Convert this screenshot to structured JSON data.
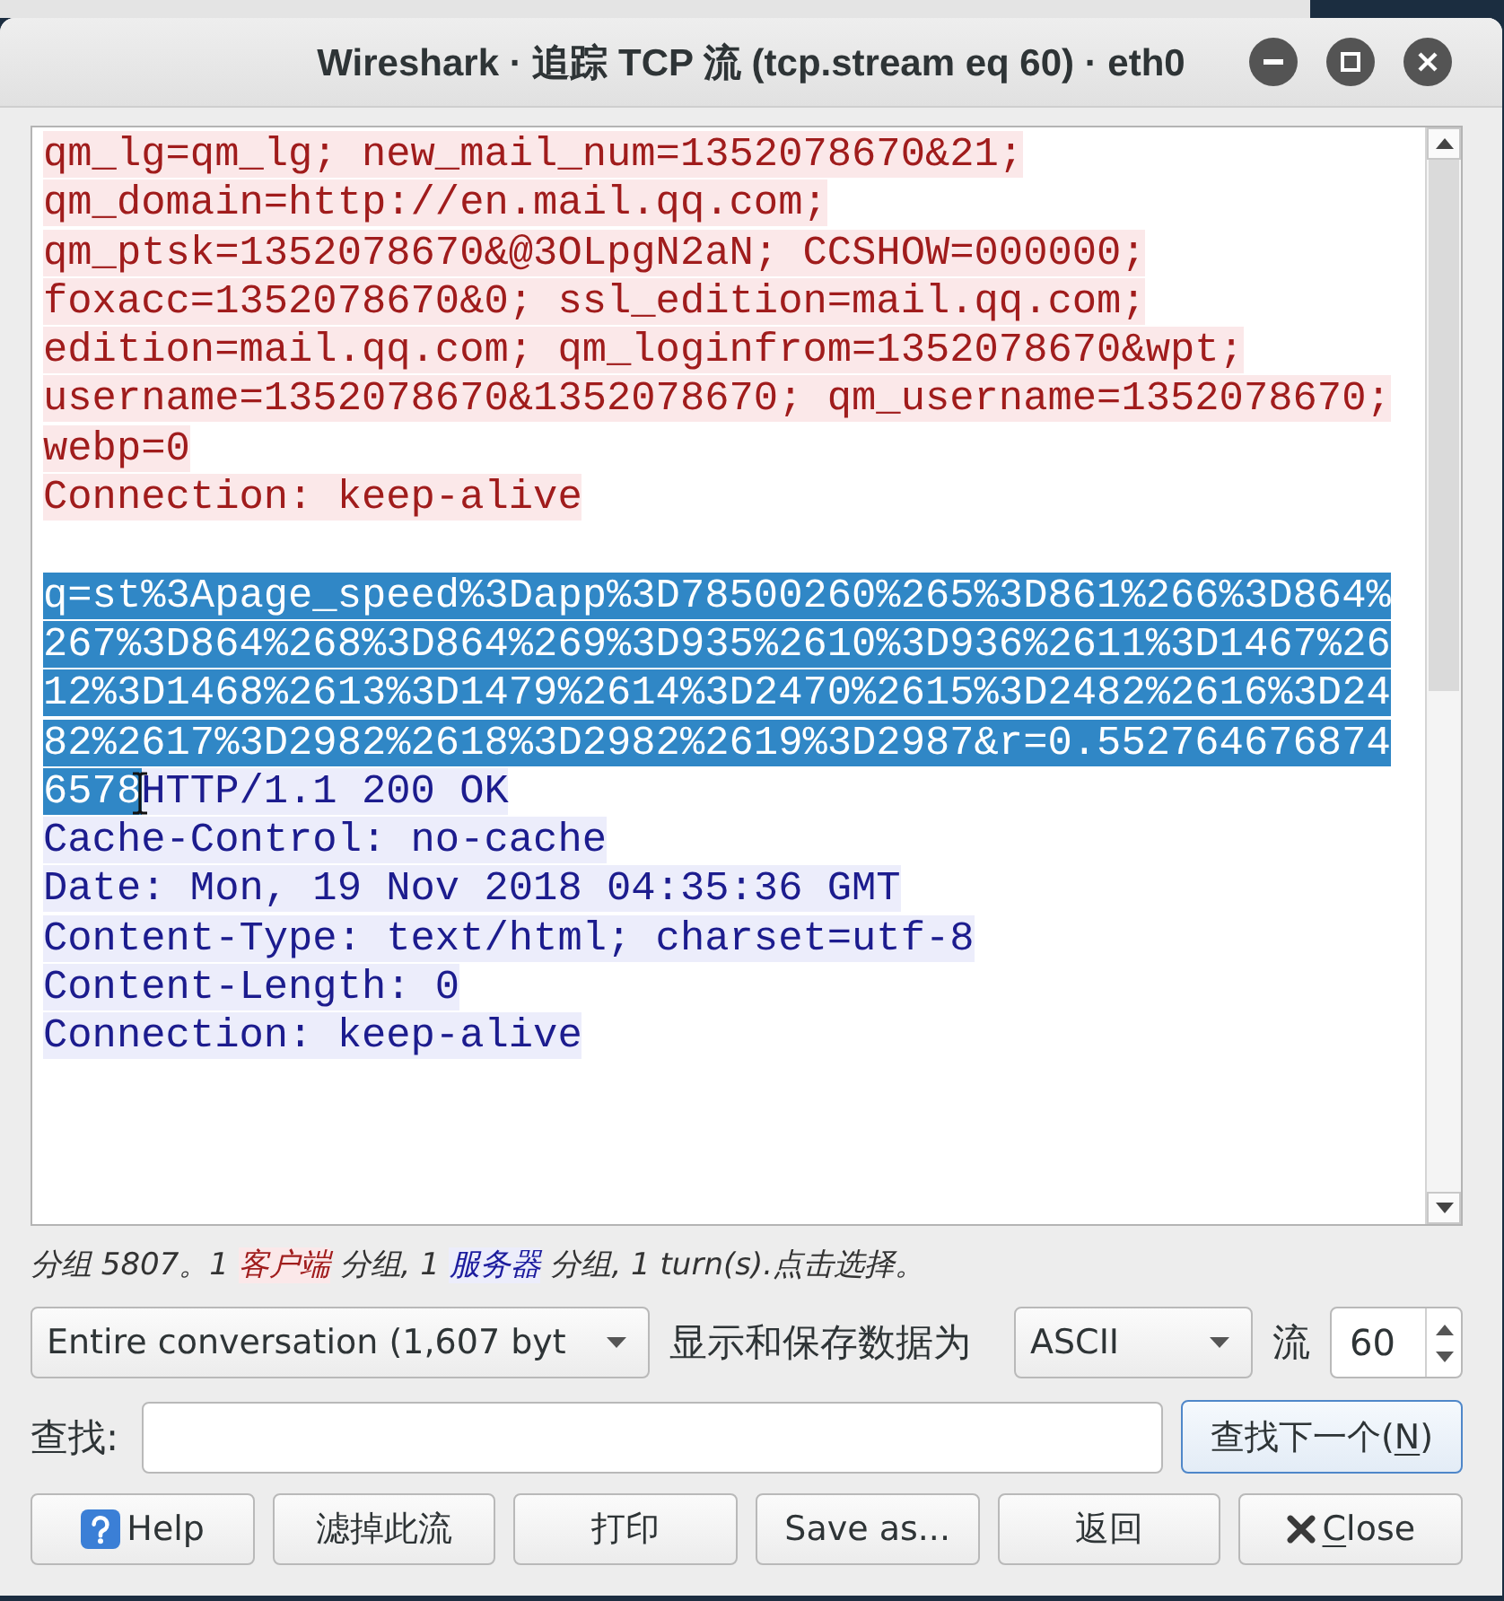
{
  "window": {
    "title": "Wireshark · 追踪 TCP 流 (tcp.stream eq 60) · eth0"
  },
  "stream": {
    "lines": [
      {
        "kind": "text",
        "segments": [
          {
            "kind": "client",
            "selected": false,
            "text": "qm_lg=qm_lg; new_mail_num=1352078670&21;"
          }
        ]
      },
      {
        "kind": "text",
        "segments": [
          {
            "kind": "client",
            "selected": false,
            "text": "qm_domain=http://en.mail.qq.com;"
          }
        ]
      },
      {
        "kind": "text",
        "segments": [
          {
            "kind": "client",
            "selected": false,
            "text": "qm_ptsk=1352078670&@3OLpgN2aN; CCSHOW=000000;"
          }
        ]
      },
      {
        "kind": "text",
        "segments": [
          {
            "kind": "client",
            "selected": false,
            "text": "foxacc=1352078670&0; ssl_edition=mail.qq.com;"
          }
        ]
      },
      {
        "kind": "text",
        "segments": [
          {
            "kind": "client",
            "selected": false,
            "text": "edition=mail.qq.com; qm_loginfrom=1352078670&wpt;"
          }
        ]
      },
      {
        "kind": "text",
        "segments": [
          {
            "kind": "client",
            "selected": false,
            "text": "username=1352078670&1352078670; qm_username=1352078670;"
          }
        ]
      },
      {
        "kind": "text",
        "segments": [
          {
            "kind": "client",
            "selected": false,
            "text": "webp=0"
          }
        ]
      },
      {
        "kind": "text",
        "segments": [
          {
            "kind": "client",
            "selected": false,
            "text": "Connection: keep-alive"
          }
        ]
      },
      {
        "kind": "blank"
      },
      {
        "kind": "text",
        "segments": [
          {
            "kind": "client",
            "selected": true,
            "text": "q=st%3Apage_speed%3Dapp%3D78500260%265%3D861%266%3D864%"
          }
        ]
      },
      {
        "kind": "text",
        "segments": [
          {
            "kind": "client",
            "selected": true,
            "text": "267%3D864%268%3D864%269%3D935%2610%3D936%2611%3D1467%26"
          }
        ]
      },
      {
        "kind": "text",
        "segments": [
          {
            "kind": "client",
            "selected": true,
            "text": "12%3D1468%2613%3D1479%2614%3D2470%2615%3D2482%2616%3D24"
          }
        ]
      },
      {
        "kind": "text",
        "segments": [
          {
            "kind": "client",
            "selected": true,
            "text": "82%2617%3D2982%2618%3D2982%2619%3D2987&r=0.552764676874"
          }
        ]
      },
      {
        "kind": "text",
        "segments": [
          {
            "kind": "client",
            "selected": true,
            "text": "6578"
          },
          {
            "kind": "server",
            "selected": false,
            "pointer": true,
            "text": "HTTP/1.1 200 OK"
          }
        ]
      },
      {
        "kind": "text",
        "segments": [
          {
            "kind": "server",
            "selected": false,
            "text": "Cache-Control: no-cache"
          }
        ]
      },
      {
        "kind": "text",
        "segments": [
          {
            "kind": "server",
            "selected": false,
            "text": "Date: Mon, 19 Nov 2018 04:35:36 GMT"
          }
        ]
      },
      {
        "kind": "text",
        "segments": [
          {
            "kind": "server",
            "selected": false,
            "text": "Content-Type: text/html; charset=utf-8"
          }
        ]
      },
      {
        "kind": "text",
        "segments": [
          {
            "kind": "server",
            "selected": false,
            "text": "Content-Length: 0"
          }
        ]
      },
      {
        "kind": "text",
        "segments": [
          {
            "kind": "server",
            "selected": false,
            "text": "Connection: keep-alive"
          }
        ]
      }
    ]
  },
  "status": {
    "parts": [
      {
        "kind": "plain",
        "text": "分组 5807。1 "
      },
      {
        "kind": "client",
        "text": "客户端"
      },
      {
        "kind": "plain",
        "text": " 分组, 1 "
      },
      {
        "kind": "server",
        "text": "服务器"
      },
      {
        "kind": "plain",
        "text": " 分组, 1 turn(s).点击选择。"
      }
    ]
  },
  "controls": {
    "conversation_select": {
      "value": "Entire conversation (1,607 byt"
    },
    "format_label": "显示和保存数据为",
    "format_select": {
      "value": "ASCII"
    },
    "stream_label": "流",
    "stream_spin": {
      "value": "60"
    }
  },
  "find": {
    "label": "查找:",
    "next_button": {
      "focused": true,
      "label_parts": [
        {
          "text": "查找下一个(",
          "underlined": false
        },
        {
          "text": "N",
          "underlined": true
        },
        {
          "text": ")",
          "underlined": false
        }
      ]
    }
  },
  "buttons": [
    {
      "kind": "help",
      "label": "Help"
    },
    {
      "kind": "plain",
      "label": "滤掉此流"
    },
    {
      "kind": "plain",
      "label": "打印"
    },
    {
      "kind": "plain",
      "label": "Save as..."
    },
    {
      "kind": "plain",
      "label": "返回"
    },
    {
      "kind": "close",
      "label_parts": [
        {
          "text": "C",
          "underlined": true
        },
        {
          "text": "lose",
          "underlined": false
        }
      ]
    }
  ]
}
